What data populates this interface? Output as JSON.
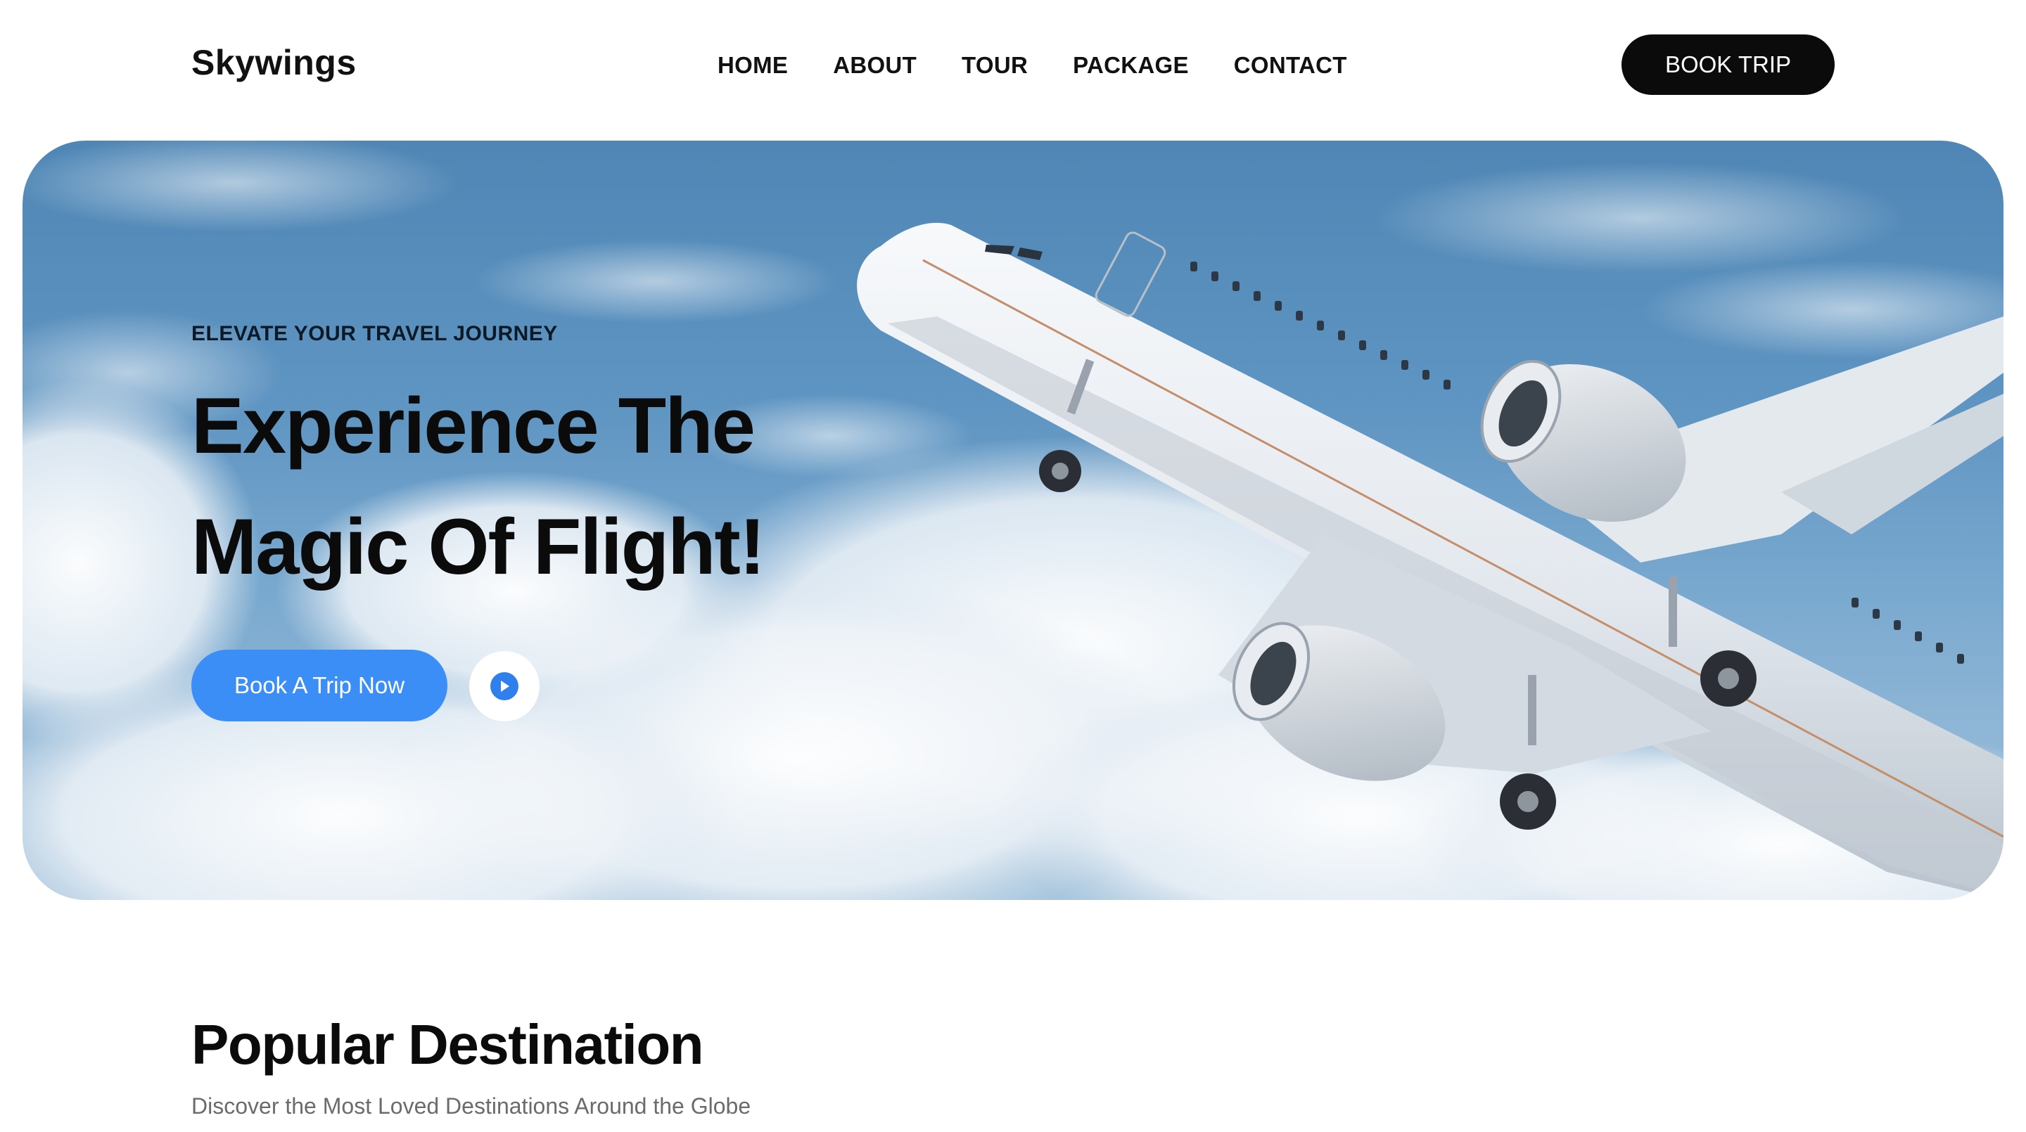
{
  "header": {
    "logo": "Skywings",
    "nav": [
      "HOME",
      "ABOUT",
      "TOUR",
      "PACKAGE",
      "CONTACT"
    ],
    "book_trip_label": "BOOK TRIP"
  },
  "hero": {
    "eyebrow": "ELEVATE YOUR TRAVEL JOURNEY",
    "title_line1": "Experience The",
    "title_line2": "Magic Of Flight!",
    "cta_label": "Book A Trip Now",
    "play_icon": "play-icon"
  },
  "destinations": {
    "title": "Popular Destination",
    "subtitle": "Discover the Most Loved Destinations Around the Globe"
  },
  "colors": {
    "accent": "#3a8ef5",
    "dark_button": "#0b0b0b",
    "sky": "#5f95c2"
  }
}
